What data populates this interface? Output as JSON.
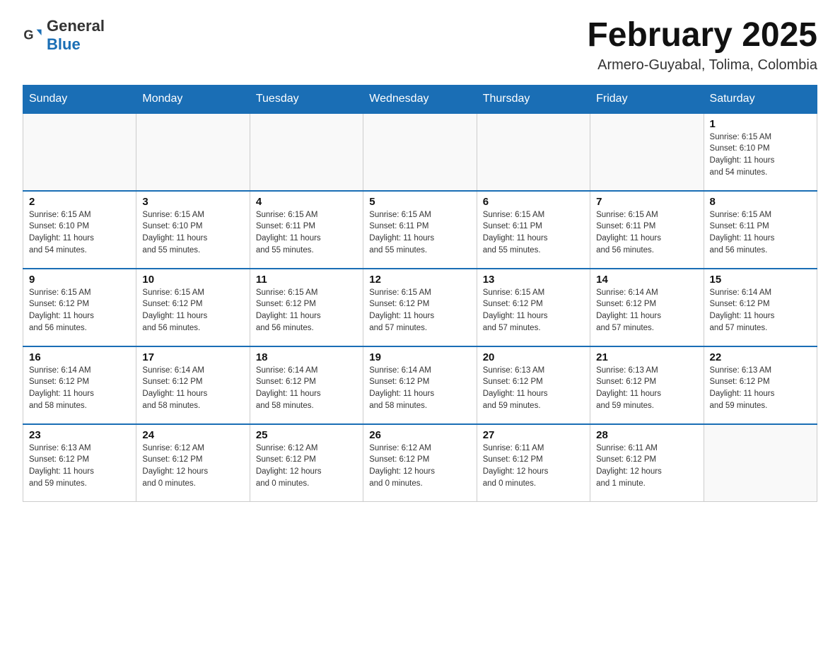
{
  "header": {
    "logo_general": "General",
    "logo_blue": "Blue",
    "month_title": "February 2025",
    "location": "Armero-Guyabal, Tolima, Colombia"
  },
  "weekdays": [
    "Sunday",
    "Monday",
    "Tuesday",
    "Wednesday",
    "Thursday",
    "Friday",
    "Saturday"
  ],
  "weeks": [
    [
      {
        "day": "",
        "info": ""
      },
      {
        "day": "",
        "info": ""
      },
      {
        "day": "",
        "info": ""
      },
      {
        "day": "",
        "info": ""
      },
      {
        "day": "",
        "info": ""
      },
      {
        "day": "",
        "info": ""
      },
      {
        "day": "1",
        "info": "Sunrise: 6:15 AM\nSunset: 6:10 PM\nDaylight: 11 hours\nand 54 minutes."
      }
    ],
    [
      {
        "day": "2",
        "info": "Sunrise: 6:15 AM\nSunset: 6:10 PM\nDaylight: 11 hours\nand 54 minutes."
      },
      {
        "day": "3",
        "info": "Sunrise: 6:15 AM\nSunset: 6:10 PM\nDaylight: 11 hours\nand 55 minutes."
      },
      {
        "day": "4",
        "info": "Sunrise: 6:15 AM\nSunset: 6:11 PM\nDaylight: 11 hours\nand 55 minutes."
      },
      {
        "day": "5",
        "info": "Sunrise: 6:15 AM\nSunset: 6:11 PM\nDaylight: 11 hours\nand 55 minutes."
      },
      {
        "day": "6",
        "info": "Sunrise: 6:15 AM\nSunset: 6:11 PM\nDaylight: 11 hours\nand 55 minutes."
      },
      {
        "day": "7",
        "info": "Sunrise: 6:15 AM\nSunset: 6:11 PM\nDaylight: 11 hours\nand 56 minutes."
      },
      {
        "day": "8",
        "info": "Sunrise: 6:15 AM\nSunset: 6:11 PM\nDaylight: 11 hours\nand 56 minutes."
      }
    ],
    [
      {
        "day": "9",
        "info": "Sunrise: 6:15 AM\nSunset: 6:12 PM\nDaylight: 11 hours\nand 56 minutes."
      },
      {
        "day": "10",
        "info": "Sunrise: 6:15 AM\nSunset: 6:12 PM\nDaylight: 11 hours\nand 56 minutes."
      },
      {
        "day": "11",
        "info": "Sunrise: 6:15 AM\nSunset: 6:12 PM\nDaylight: 11 hours\nand 56 minutes."
      },
      {
        "day": "12",
        "info": "Sunrise: 6:15 AM\nSunset: 6:12 PM\nDaylight: 11 hours\nand 57 minutes."
      },
      {
        "day": "13",
        "info": "Sunrise: 6:15 AM\nSunset: 6:12 PM\nDaylight: 11 hours\nand 57 minutes."
      },
      {
        "day": "14",
        "info": "Sunrise: 6:14 AM\nSunset: 6:12 PM\nDaylight: 11 hours\nand 57 minutes."
      },
      {
        "day": "15",
        "info": "Sunrise: 6:14 AM\nSunset: 6:12 PM\nDaylight: 11 hours\nand 57 minutes."
      }
    ],
    [
      {
        "day": "16",
        "info": "Sunrise: 6:14 AM\nSunset: 6:12 PM\nDaylight: 11 hours\nand 58 minutes."
      },
      {
        "day": "17",
        "info": "Sunrise: 6:14 AM\nSunset: 6:12 PM\nDaylight: 11 hours\nand 58 minutes."
      },
      {
        "day": "18",
        "info": "Sunrise: 6:14 AM\nSunset: 6:12 PM\nDaylight: 11 hours\nand 58 minutes."
      },
      {
        "day": "19",
        "info": "Sunrise: 6:14 AM\nSunset: 6:12 PM\nDaylight: 11 hours\nand 58 minutes."
      },
      {
        "day": "20",
        "info": "Sunrise: 6:13 AM\nSunset: 6:12 PM\nDaylight: 11 hours\nand 59 minutes."
      },
      {
        "day": "21",
        "info": "Sunrise: 6:13 AM\nSunset: 6:12 PM\nDaylight: 11 hours\nand 59 minutes."
      },
      {
        "day": "22",
        "info": "Sunrise: 6:13 AM\nSunset: 6:12 PM\nDaylight: 11 hours\nand 59 minutes."
      }
    ],
    [
      {
        "day": "23",
        "info": "Sunrise: 6:13 AM\nSunset: 6:12 PM\nDaylight: 11 hours\nand 59 minutes."
      },
      {
        "day": "24",
        "info": "Sunrise: 6:12 AM\nSunset: 6:12 PM\nDaylight: 12 hours\nand 0 minutes."
      },
      {
        "day": "25",
        "info": "Sunrise: 6:12 AM\nSunset: 6:12 PM\nDaylight: 12 hours\nand 0 minutes."
      },
      {
        "day": "26",
        "info": "Sunrise: 6:12 AM\nSunset: 6:12 PM\nDaylight: 12 hours\nand 0 minutes."
      },
      {
        "day": "27",
        "info": "Sunrise: 6:11 AM\nSunset: 6:12 PM\nDaylight: 12 hours\nand 0 minutes."
      },
      {
        "day": "28",
        "info": "Sunrise: 6:11 AM\nSunset: 6:12 PM\nDaylight: 12 hours\nand 1 minute."
      },
      {
        "day": "",
        "info": ""
      }
    ]
  ]
}
